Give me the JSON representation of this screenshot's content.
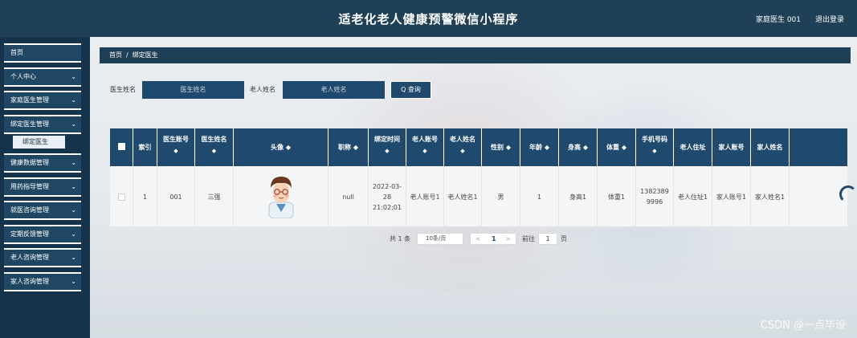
{
  "header": {
    "title": "适老化老人健康预警微信小程序",
    "user": "家庭医生 001",
    "logout": "退出登录"
  },
  "sidebar": {
    "items": [
      {
        "label": "首页",
        "chevron": ""
      },
      {
        "label": "个人中心",
        "chevron": "⌄"
      },
      {
        "label": "家庭医生管理",
        "chevron": "⌄"
      },
      {
        "label": "绑定医生管理",
        "chevron": "⌄"
      },
      {
        "label": "健康数据管理",
        "chevron": "⌄"
      },
      {
        "label": "用药指导管理",
        "chevron": "⌄"
      },
      {
        "label": "就医咨询管理",
        "chevron": "⌄"
      },
      {
        "label": "定期反馈管理",
        "chevron": "⌄"
      },
      {
        "label": "老人咨询管理",
        "chevron": "⌄"
      },
      {
        "label": "家人咨询管理",
        "chevron": "⌄"
      }
    ],
    "sub_item": "绑定医生"
  },
  "breadcrumb": {
    "home": "首页",
    "sep": "/",
    "current": "绑定医生"
  },
  "search": {
    "doctor_label": "医生姓名",
    "doctor_placeholder": "医生姓名",
    "elder_label": "老人姓名",
    "elder_placeholder": "老人姓名",
    "button": "Q 查询"
  },
  "table": {
    "headers": [
      "索引",
      "医生账号",
      "医生姓名",
      "头像",
      "职称",
      "绑定时间",
      "老人账号",
      "老人姓名",
      "性别",
      "年龄",
      "身高",
      "体重",
      "手机号码",
      "老人住址",
      "家人账号",
      "家人姓名"
    ],
    "sort_glyph": "◆",
    "row": {
      "index": "1",
      "doctor_account": "001",
      "doctor_name": "三强",
      "title": "null",
      "bind_time": "2022-03-28 21:02:01",
      "elder_account": "老人账号1",
      "elder_name": "老人姓名1",
      "gender": "男",
      "age": "1",
      "height": "身高1",
      "weight": "体重1",
      "phone": "13823899996",
      "address": "老人住址1",
      "family_account": "家人账号1",
      "family_name": "家人姓名1"
    }
  },
  "pager": {
    "total": "共 1 条",
    "page_size": "10条/页",
    "prev": "<",
    "page": "1",
    "next": ">",
    "goto": "前往",
    "goto_value": "1",
    "page_word": "页"
  },
  "watermark": "CSDN @一点毕设"
}
